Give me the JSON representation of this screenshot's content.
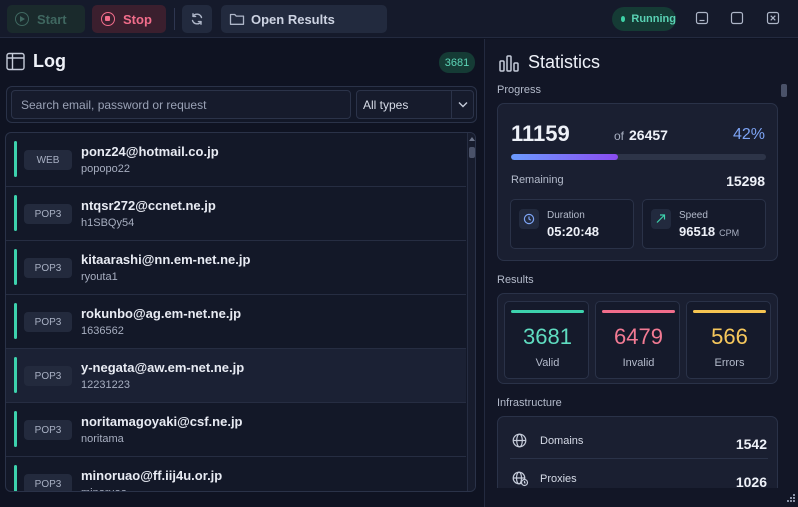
{
  "toolbar": {
    "start_label": "Start",
    "stop_label": "Stop",
    "open_results_label": "Open Results",
    "status": "Running"
  },
  "log": {
    "title": "Log",
    "count": "3681",
    "search_placeholder": "Search email, password or request",
    "type_filter": "All types",
    "entries": [
      {
        "type": "WEB",
        "email": "ponz24@hotmail.co.jp",
        "password": "popopo22"
      },
      {
        "type": "POP3",
        "email": "ntqsr272@ccnet.ne.jp",
        "password": "h1SBQy54"
      },
      {
        "type": "POP3",
        "email": "kitaarashi@nn.em-net.ne.jp",
        "password": "ryouta1"
      },
      {
        "type": "POP3",
        "email": "rokunbo@ag.em-net.ne.jp",
        "password": "1636562"
      },
      {
        "type": "POP3",
        "email": "y-negata@aw.em-net.ne.jp",
        "password": "12231223"
      },
      {
        "type": "POP3",
        "email": "noritamagoyaki@csf.ne.jp",
        "password": "noritama"
      },
      {
        "type": "POP3",
        "email": "minoruao@ff.iij4u.or.jp",
        "password": "minoruao"
      }
    ]
  },
  "stats": {
    "title": "Statistics",
    "progress": {
      "section_label": "Progress",
      "checked": "11159",
      "of_label": "of",
      "total": "26457",
      "percent_label": "42%",
      "percent_fraction": 0.42,
      "remaining_label": "Remaining",
      "remaining": "15298",
      "duration_label": "Duration",
      "duration": "05:20:48",
      "speed_label": "Speed",
      "speed": "96518",
      "speed_unit": "CPM"
    },
    "results": {
      "section_label": "Results",
      "valid": "3681",
      "valid_label": "Valid",
      "valid_color": "#3dd2ad",
      "invalid": "6479",
      "invalid_label": "Invalid",
      "invalid_color": "#f16d8b",
      "errors": "566",
      "errors_label": "Errors",
      "errors_color": "#f5c451"
    },
    "infrastructure": {
      "section_label": "Infrastructure",
      "domains_label": "Domains",
      "domains": "1542",
      "proxies_label": "Proxies",
      "proxies": "1026"
    }
  }
}
